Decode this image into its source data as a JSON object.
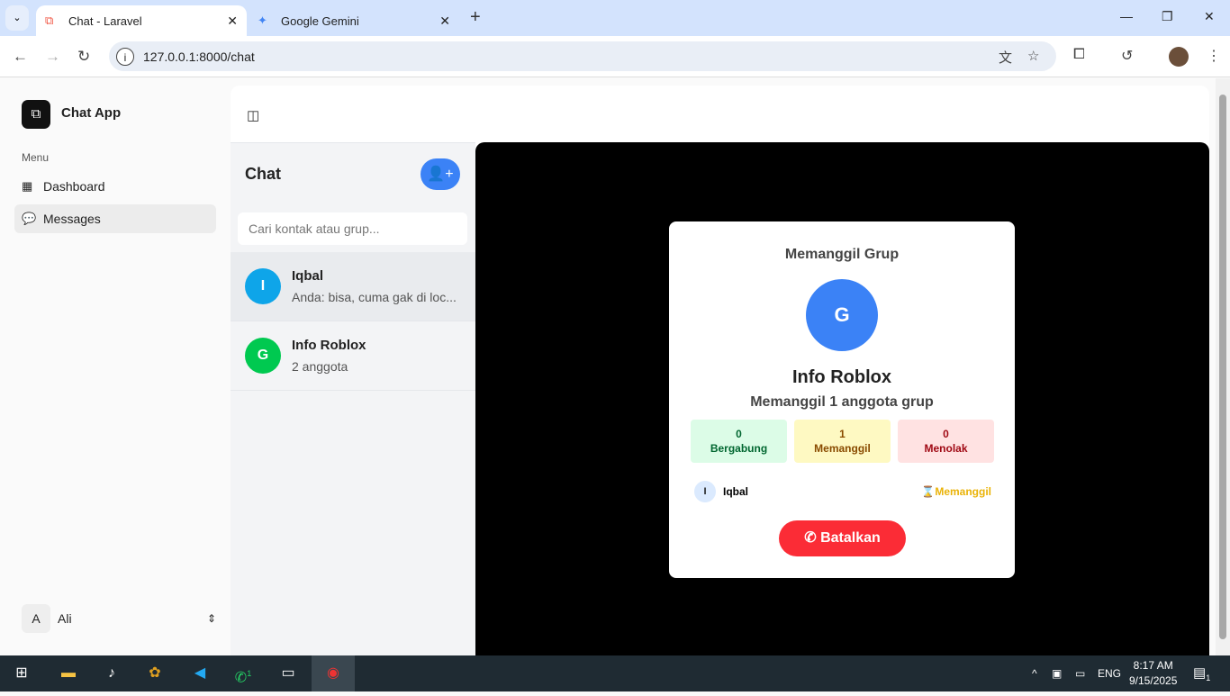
{
  "browser": {
    "tabs": [
      {
        "title": "Chat - Laravel",
        "active": true
      },
      {
        "title": "Google Gemini",
        "active": false
      }
    ],
    "url": "127.0.0.1:8000/chat"
  },
  "sidebar": {
    "app_name": "Chat App",
    "menu_label": "Menu",
    "items": [
      {
        "label": "Dashboard",
        "icon": "grid-icon"
      },
      {
        "label": "Messages",
        "icon": "chat-icon",
        "active": true
      }
    ],
    "user": {
      "initial": "A",
      "name": "Ali"
    }
  },
  "chat": {
    "title": "Chat",
    "search_placeholder": "Cari kontak atau grup...",
    "contacts": [
      {
        "initial": "I",
        "name": "Iqbal",
        "preview": "Anda: bisa, cuma gak di loc...",
        "color": "#0ea5e9"
      },
      {
        "initial": "G",
        "name": "Info Roblox",
        "preview": "2 anggota",
        "color": "#00c950"
      }
    ]
  },
  "call": {
    "heading": "Memanggil Grup",
    "initial": "G",
    "group_name": "Info Roblox",
    "subtitle": "Memanggil 1 anggota grup",
    "stats": [
      {
        "count": "0",
        "label": "Bergabung",
        "bg": "#dcfce7",
        "color": "#016630"
      },
      {
        "count": "1",
        "label": "Memanggil",
        "bg": "#fef9c2",
        "color": "#894b00"
      },
      {
        "count": "0",
        "label": "Menolak",
        "bg": "#ffe2e2",
        "color": "#9f0712"
      }
    ],
    "members": [
      {
        "initial": "I",
        "name": "Iqbal",
        "status": "Memanggil",
        "status_icon": "⌛"
      }
    ],
    "cancel_label": "Batalkan"
  },
  "taskbar": {
    "language": "ENG",
    "time": "8:17 AM",
    "date": "9/15/2025",
    "notifications": "1",
    "whatsapp_badge": "1"
  }
}
